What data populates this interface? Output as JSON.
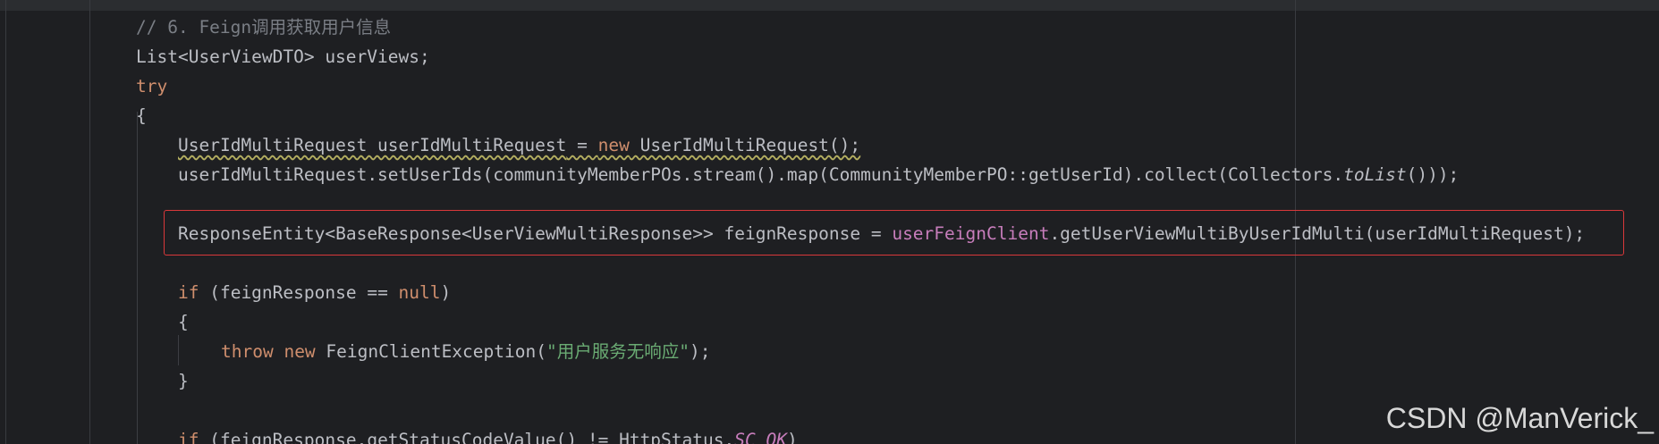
{
  "code": {
    "l1_comment": "// 6. Feign调用获取用户信息",
    "l2_text": "List<UserViewDTO> userViews;",
    "l3_kw": "try",
    "l4_brace": "{",
    "l5_type": "UserIdMultiRequest userIdMultiRequest",
    "l5_assign": " = ",
    "l5_new": "new",
    "l5_ctor": " UserIdMultiRequest();",
    "l6_pre": "userIdMultiRequest.setUserIds(communityMemberPOs.stream().map(CommunityMemberPO::getUserId).collect(Collectors.",
    "l6_method": "toList",
    "l6_post": "()));",
    "l8_pre": "ResponseEntity<BaseResponse<UserViewMultiResponse>> feignResponse = ",
    "l8_field": "userFeignClient",
    "l8_post": ".getUserViewMultiByUserIdMulti(userIdMultiRequest);",
    "l10_if": "if",
    "l10_mid": " (feignResponse == ",
    "l10_null": "null",
    "l10_end": ")",
    "l11_brace": "{",
    "l12_throw": "throw",
    "l12_new": "new",
    "l12_cls": " FeignClientException(",
    "l12_str": "\"用户服务无响应\"",
    "l12_end": ");",
    "l13_brace": "}",
    "l15_if": "if",
    "l15_mid": " (feignResponse.getStatusCodeValue() != HttpStatus.",
    "l15_const": "SC_OK",
    "l15_end": ")"
  },
  "watermark": "CSDN @ManVerick_",
  "colors": {
    "background": "#1e1f22",
    "text": "#bcbec4",
    "keyword": "#cf8e6d",
    "comment": "#7a7e85",
    "field": "#c77dbb",
    "string": "#6aab73",
    "highlight_border": "#d9383a"
  }
}
